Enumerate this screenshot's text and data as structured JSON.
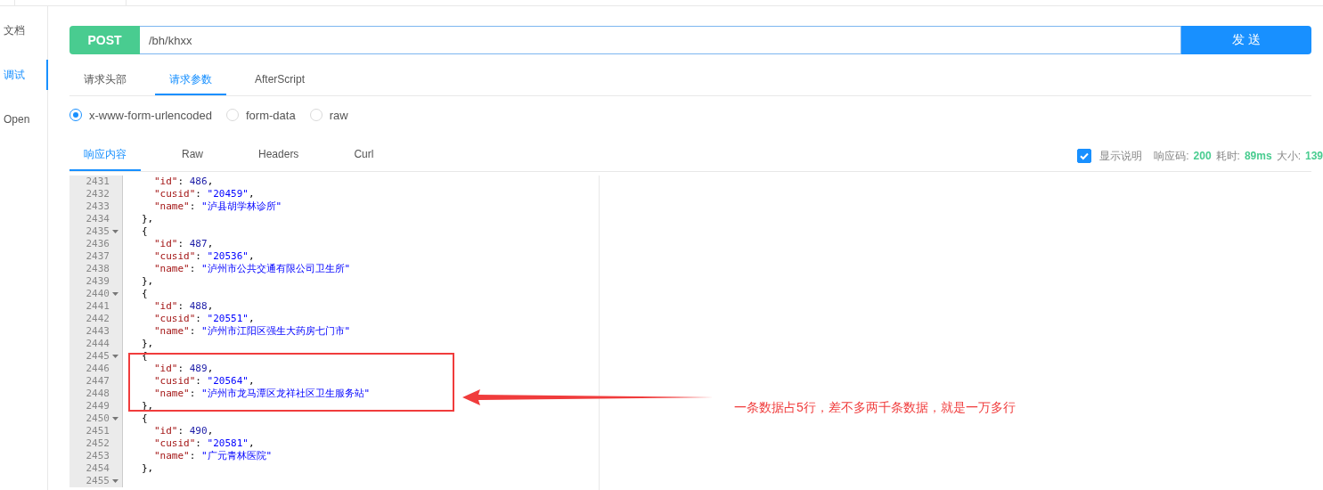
{
  "sidebar": {
    "items": [
      {
        "label": "文档",
        "selected": false
      },
      {
        "label": "调试",
        "selected": true
      },
      {
        "label": "Open",
        "selected": false
      }
    ]
  },
  "request": {
    "method": "POST",
    "url": "/bh/khxx",
    "send_label": "发 送"
  },
  "request_tabs": [
    {
      "label": "请求头部",
      "selected": false
    },
    {
      "label": "请求参数",
      "selected": true
    },
    {
      "label": "AfterScript",
      "selected": false
    }
  ],
  "body_types": [
    {
      "label": "x-www-form-urlencoded",
      "selected": true
    },
    {
      "label": "form-data",
      "selected": false
    },
    {
      "label": "raw",
      "selected": false
    }
  ],
  "response_tabs": [
    {
      "label": "响应内容",
      "selected": true
    },
    {
      "label": "Raw",
      "selected": false
    },
    {
      "label": "Headers",
      "selected": false
    },
    {
      "label": "Curl",
      "selected": false
    }
  ],
  "response_meta": {
    "show_description": {
      "label": "显示说明",
      "checked": true
    },
    "stats": [
      {
        "label": "响应码:",
        "value": "200"
      },
      {
        "label": "耗时:",
        "value": "89ms"
      },
      {
        "label": "大小:",
        "value": "139"
      }
    ]
  },
  "code_lines": [
    {
      "number": "2431",
      "foldable": false,
      "kind": "field",
      "tokens": [
        {
          "kind": "key",
          "text": "\"id\""
        },
        {
          "kind": "punct",
          "text": ": "
        },
        {
          "kind": "number",
          "text": "486"
        },
        {
          "kind": "punct",
          "text": ","
        }
      ]
    },
    {
      "number": "2432",
      "foldable": false,
      "kind": "field",
      "tokens": [
        {
          "kind": "key",
          "text": "\"cusid\""
        },
        {
          "kind": "punct",
          "text": ": "
        },
        {
          "kind": "string",
          "text": "\"20459\""
        },
        {
          "kind": "punct",
          "text": ","
        }
      ]
    },
    {
      "number": "2433",
      "foldable": false,
      "kind": "field",
      "tokens": [
        {
          "kind": "key",
          "text": "\"name\""
        },
        {
          "kind": "punct",
          "text": ": "
        },
        {
          "kind": "string",
          "text": "\"泸县胡学林诊所\""
        }
      ]
    },
    {
      "number": "2434",
      "foldable": false,
      "kind": "brace",
      "tokens": [
        {
          "kind": "punct",
          "text": "},"
        }
      ]
    },
    {
      "number": "2435",
      "foldable": true,
      "kind": "brace",
      "tokens": [
        {
          "kind": "punct",
          "text": "{"
        }
      ]
    },
    {
      "number": "2436",
      "foldable": false,
      "kind": "field",
      "tokens": [
        {
          "kind": "key",
          "text": "\"id\""
        },
        {
          "kind": "punct",
          "text": ": "
        },
        {
          "kind": "number",
          "text": "487"
        },
        {
          "kind": "punct",
          "text": ","
        }
      ]
    },
    {
      "number": "2437",
      "foldable": false,
      "kind": "field",
      "tokens": [
        {
          "kind": "key",
          "text": "\"cusid\""
        },
        {
          "kind": "punct",
          "text": ": "
        },
        {
          "kind": "string",
          "text": "\"20536\""
        },
        {
          "kind": "punct",
          "text": ","
        }
      ]
    },
    {
      "number": "2438",
      "foldable": false,
      "kind": "field",
      "tokens": [
        {
          "kind": "key",
          "text": "\"name\""
        },
        {
          "kind": "punct",
          "text": ": "
        },
        {
          "kind": "string",
          "text": "\"泸州市公共交通有限公司卫生所\""
        }
      ]
    },
    {
      "number": "2439",
      "foldable": false,
      "kind": "brace",
      "tokens": [
        {
          "kind": "punct",
          "text": "},"
        }
      ]
    },
    {
      "number": "2440",
      "foldable": true,
      "kind": "brace",
      "tokens": [
        {
          "kind": "punct",
          "text": "{"
        }
      ]
    },
    {
      "number": "2441",
      "foldable": false,
      "kind": "field",
      "tokens": [
        {
          "kind": "key",
          "text": "\"id\""
        },
        {
          "kind": "punct",
          "text": ": "
        },
        {
          "kind": "number",
          "text": "488"
        },
        {
          "kind": "punct",
          "text": ","
        }
      ]
    },
    {
      "number": "2442",
      "foldable": false,
      "kind": "field",
      "tokens": [
        {
          "kind": "key",
          "text": "\"cusid\""
        },
        {
          "kind": "punct",
          "text": ": "
        },
        {
          "kind": "string",
          "text": "\"20551\""
        },
        {
          "kind": "punct",
          "text": ","
        }
      ]
    },
    {
      "number": "2443",
      "foldable": false,
      "kind": "field",
      "tokens": [
        {
          "kind": "key",
          "text": "\"name\""
        },
        {
          "kind": "punct",
          "text": ": "
        },
        {
          "kind": "string",
          "text": "\"泸州市江阳区强生大药房七门市\""
        }
      ]
    },
    {
      "number": "2444",
      "foldable": false,
      "kind": "brace",
      "tokens": [
        {
          "kind": "punct",
          "text": "},"
        }
      ]
    },
    {
      "number": "2445",
      "foldable": true,
      "kind": "brace",
      "tokens": [
        {
          "kind": "punct",
          "text": "{"
        }
      ]
    },
    {
      "number": "2446",
      "foldable": false,
      "kind": "field",
      "tokens": [
        {
          "kind": "key",
          "text": "\"id\""
        },
        {
          "kind": "punct",
          "text": ": "
        },
        {
          "kind": "number",
          "text": "489"
        },
        {
          "kind": "punct",
          "text": ","
        }
      ]
    },
    {
      "number": "2447",
      "foldable": false,
      "kind": "field",
      "tokens": [
        {
          "kind": "key",
          "text": "\"cusid\""
        },
        {
          "kind": "punct",
          "text": ": "
        },
        {
          "kind": "string",
          "text": "\"20564\""
        },
        {
          "kind": "punct",
          "text": ","
        }
      ]
    },
    {
      "number": "2448",
      "foldable": false,
      "kind": "field",
      "tokens": [
        {
          "kind": "key",
          "text": "\"name\""
        },
        {
          "kind": "punct",
          "text": ": "
        },
        {
          "kind": "string",
          "text": "\"泸州市龙马潭区龙祥社区卫生服务站\""
        }
      ]
    },
    {
      "number": "2449",
      "foldable": false,
      "kind": "brace",
      "tokens": [
        {
          "kind": "punct",
          "text": "},"
        }
      ]
    },
    {
      "number": "2450",
      "foldable": true,
      "kind": "brace",
      "tokens": [
        {
          "kind": "punct",
          "text": "{"
        }
      ]
    },
    {
      "number": "2451",
      "foldable": false,
      "kind": "field",
      "tokens": [
        {
          "kind": "key",
          "text": "\"id\""
        },
        {
          "kind": "punct",
          "text": ": "
        },
        {
          "kind": "number",
          "text": "490"
        },
        {
          "kind": "punct",
          "text": ","
        }
      ]
    },
    {
      "number": "2452",
      "foldable": false,
      "kind": "field",
      "tokens": [
        {
          "kind": "key",
          "text": "\"cusid\""
        },
        {
          "kind": "punct",
          "text": ": "
        },
        {
          "kind": "string",
          "text": "\"20581\""
        },
        {
          "kind": "punct",
          "text": ","
        }
      ]
    },
    {
      "number": "2453",
      "foldable": false,
      "kind": "field",
      "tokens": [
        {
          "kind": "key",
          "text": "\"name\""
        },
        {
          "kind": "punct",
          "text": ": "
        },
        {
          "kind": "string",
          "text": "\"广元青林医院\""
        }
      ]
    },
    {
      "number": "2454",
      "foldable": false,
      "kind": "brace",
      "tokens": [
        {
          "kind": "punct",
          "text": "},"
        }
      ]
    },
    {
      "number": "2455",
      "foldable": true
    }
  ],
  "annotation": {
    "text": "一条数据占5行，差不多两千条数据，就是一万多行"
  }
}
